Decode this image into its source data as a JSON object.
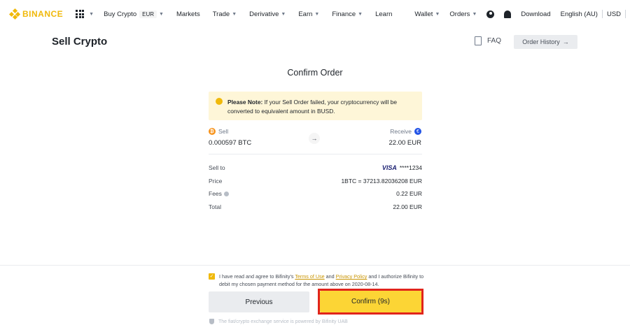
{
  "nav": {
    "logo": "BINANCE",
    "items": [
      {
        "label": "Buy Crypto",
        "badge": "EUR",
        "caret": true
      },
      {
        "label": "Markets",
        "caret": false
      },
      {
        "label": "Trade",
        "caret": true
      },
      {
        "label": "Derivative",
        "caret": true
      },
      {
        "label": "Earn",
        "caret": true
      },
      {
        "label": "Finance",
        "caret": true
      },
      {
        "label": "Learn",
        "caret": false
      }
    ],
    "wallet": "Wallet",
    "orders": "Orders",
    "download": "Download",
    "language": "English (AU)",
    "currency": "USD"
  },
  "header": {
    "title": "Sell Crypto",
    "faq": "FAQ",
    "order_history": "Order History"
  },
  "card": {
    "title": "Confirm Order",
    "note_bold": "Please Note:",
    "note_text": " If your Sell Order failed, your cryptocurrency will be converted to equivalent amount in BUSD.",
    "sell_label": "Sell",
    "sell_amount": "0.000597 BTC",
    "receive_label": "Receive",
    "receive_amount": "22.00 EUR",
    "details": [
      {
        "label": "Sell to",
        "value": "****1234",
        "card_brand": "VISA"
      },
      {
        "label": "Price",
        "value": "1BTC = 37213.82036208 EUR"
      },
      {
        "label": "Fees",
        "value": "0.22 EUR",
        "info": true
      },
      {
        "label": "Total",
        "value": "22.00 EUR"
      }
    ]
  },
  "footer": {
    "agree_prefix": "I have read and agree to Bifinity's ",
    "terms": "Terms of Use",
    "and": " and ",
    "privacy": "Privacy Policy",
    "agree_suffix": " and I authorize Bifinity to debit my chosen payment method for the amount above on 2020-08-14.",
    "previous": "Previous",
    "confirm": "Confirm (9s)",
    "powered": "The fiat/crypto exchange service is powered by Bifinity UAB"
  },
  "colors": {
    "brand": "#f0b90b",
    "confirm_button": "#fcd535",
    "highlight_frame": "#e1251b",
    "note_bg": "#fef6d8"
  }
}
